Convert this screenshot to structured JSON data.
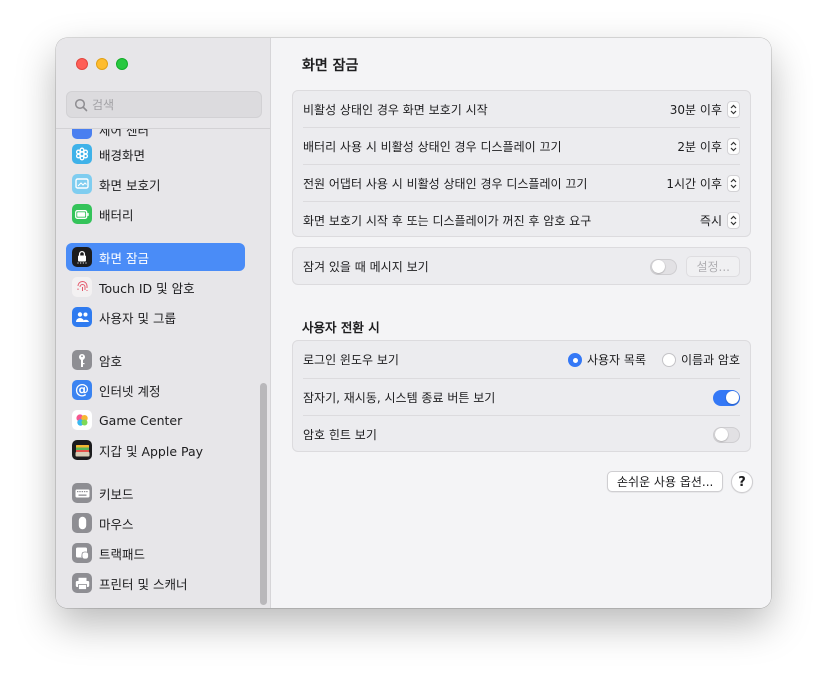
{
  "sidebar": {
    "search_placeholder": "검색",
    "partial_item": "제어 센터",
    "items": [
      {
        "label": "배경화면"
      },
      {
        "label": "화면 보호기"
      },
      {
        "label": "배터리"
      },
      {
        "label": "화면 잠금"
      },
      {
        "label": "Touch ID 및 암호"
      },
      {
        "label": "사용자 및 그룹"
      },
      {
        "label": "암호"
      },
      {
        "label": "인터넷 계정"
      },
      {
        "label": "Game Center"
      },
      {
        "label": "지갑 및 Apple Pay"
      },
      {
        "label": "키보드"
      },
      {
        "label": "마우스"
      },
      {
        "label": "트랙패드"
      },
      {
        "label": "프린터 및 스캐너"
      }
    ],
    "selected": "화면 잠금"
  },
  "main": {
    "title": "화면 잠금",
    "timing_rows": [
      {
        "label": "비활성 상태인 경우 화면 보호기 시작",
        "value": "30분 이후"
      },
      {
        "label": "배터리 사용 시 비활성 상태인 경우 디스플레이 끄기",
        "value": "2분 이후"
      },
      {
        "label": "전원 어댑터 사용 시 비활성 상태인 경우 디스플레이 끄기",
        "value": "1시간 이후"
      },
      {
        "label": "화면 보호기 시작 후 또는 디스플레이가 꺼진 후 암호 요구",
        "value": "즉시"
      }
    ],
    "lock_message": {
      "label": "잠겨 있을 때 메시지 보기",
      "enabled": false,
      "button": "설정..."
    },
    "user_switch": {
      "title": "사용자 전환 시",
      "login_window_label": "로그인 윈도우 보기",
      "options": [
        "사용자 목록",
        "이름과 암호"
      ],
      "selected_option": "사용자 목록",
      "sleep_restart_label": "잠자기, 재시동, 시스템 종료 버튼 보기",
      "sleep_restart_enabled": true,
      "password_hint_label": "암호 힌트 보기",
      "password_hint_enabled": false
    },
    "accessibility_button": "손쉬운 사용 옵션...",
    "help_label": "?"
  },
  "colors": {
    "accent": "#3478f6",
    "sidebar_selected": "#4a8cf7",
    "traffic_red": "#fe5f57",
    "traffic_yellow": "#febc2e",
    "traffic_green": "#28c840"
  }
}
